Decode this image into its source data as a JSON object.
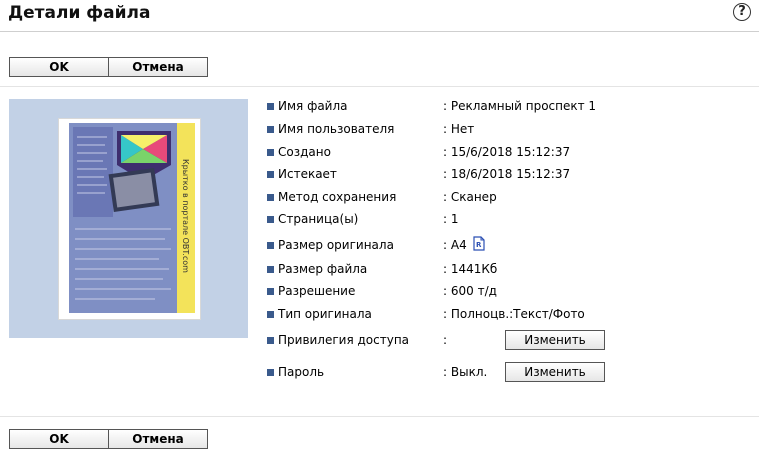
{
  "header": {
    "title": "Детали файла",
    "help_label": "?"
  },
  "buttons": {
    "ok": "OK",
    "cancel": "Отмена"
  },
  "details": {
    "file_name": {
      "label": "Имя файла",
      "value": ": Рекламный проспект 1"
    },
    "user_name": {
      "label": "Имя пользователя",
      "value": ": Нет"
    },
    "created": {
      "label": "Создано",
      "value": ": 15/6/2018 15:12:37"
    },
    "expires": {
      "label": "Истекает",
      "value": ": 18/6/2018 15:12:37"
    },
    "save_method": {
      "label": "Метод сохранения",
      "value": ": Сканер"
    },
    "pages": {
      "label": "Страница(ы)",
      "value": ": 1"
    },
    "orig_size": {
      "label": "Размер оригинала",
      "value": ": A4"
    },
    "file_size": {
      "label": "Размер файла",
      "value": ": 1441Кб"
    },
    "resolution": {
      "label": "Разрешение",
      "value": ": 600 т/д"
    },
    "orig_type": {
      "label": "Тип оригинала",
      "value": ": Полноцв.:Текст/Фото"
    },
    "access": {
      "label": "Привилегия доступа",
      "value": ":",
      "button": "Изменить"
    },
    "password": {
      "label": "Пароль",
      "value": ": Выкл.",
      "button": "Изменить"
    }
  },
  "preview": {
    "caption": "Крытко в портале OBT.com"
  },
  "colors": {
    "bullet": "#3a5a8c",
    "preview_bg": "#c2d1e6"
  }
}
